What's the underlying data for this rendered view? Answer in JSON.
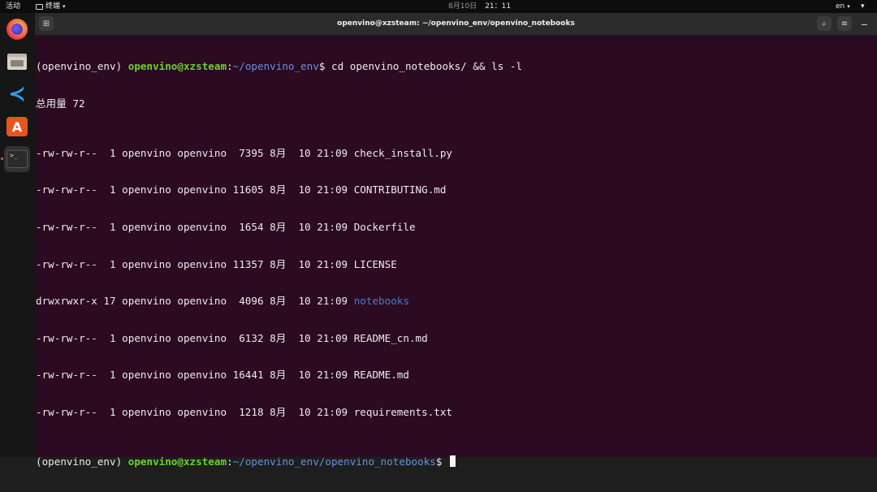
{
  "topbar": {
    "activities": "活动",
    "app_name": "终端",
    "date": "8月10日",
    "time": "21：11",
    "lang": "en"
  },
  "dock": {
    "items": [
      {
        "name": "firefox-icon"
      },
      {
        "name": "files-icon"
      },
      {
        "name": "vscode-icon"
      },
      {
        "name": "software-center-icon"
      },
      {
        "name": "terminal-icon"
      }
    ],
    "terminal_glyph": ">_",
    "store_glyph": "A"
  },
  "window": {
    "title": "openvino@xzsteam: ~/openvino_env/openvino_notebooks"
  },
  "terminal": {
    "prompt1": {
      "env": "(openvino_env) ",
      "user": "openvino@xzsteam",
      "colon": ":",
      "path": "~/openvino_env",
      "suffix": "$ ",
      "command": "cd openvino_notebooks/ && ls -l"
    },
    "total": "总用量 72",
    "entries": [
      {
        "meta": "-rw-rw-r--  1 openvino openvino  7395 8月  10 21:09 ",
        "name": "check_install.py",
        "is_dir": false
      },
      {
        "meta": "-rw-rw-r--  1 openvino openvino 11605 8月  10 21:09 ",
        "name": "CONTRIBUTING.md",
        "is_dir": false
      },
      {
        "meta": "-rw-rw-r--  1 openvino openvino  1654 8月  10 21:09 ",
        "name": "Dockerfile",
        "is_dir": false
      },
      {
        "meta": "-rw-rw-r--  1 openvino openvino 11357 8月  10 21:09 ",
        "name": "LICENSE",
        "is_dir": false
      },
      {
        "meta": "drwxrwxr-x 17 openvino openvino  4096 8月  10 21:09 ",
        "name": "notebooks",
        "is_dir": true
      },
      {
        "meta": "-rw-rw-r--  1 openvino openvino  6132 8月  10 21:09 ",
        "name": "README_cn.md",
        "is_dir": false
      },
      {
        "meta": "-rw-rw-r--  1 openvino openvino 16441 8月  10 21:09 ",
        "name": "README.md",
        "is_dir": false
      },
      {
        "meta": "-rw-rw-r--  1 openvino openvino  1218 8月  10 21:09 ",
        "name": "requirements.txt",
        "is_dir": false
      }
    ],
    "prompt2": {
      "env": "(openvino_env) ",
      "user": "openvino@xzsteam",
      "colon": ":",
      "path": "~/openvino_env/openvino_notebooks",
      "suffix": "$ "
    }
  },
  "colors": {
    "terminal_bg": "#2c0a22",
    "prompt_user": "#6ad32b",
    "prompt_path": "#6c8fe0",
    "directory": "#3f7fd6",
    "accent": "#e66a2c"
  }
}
